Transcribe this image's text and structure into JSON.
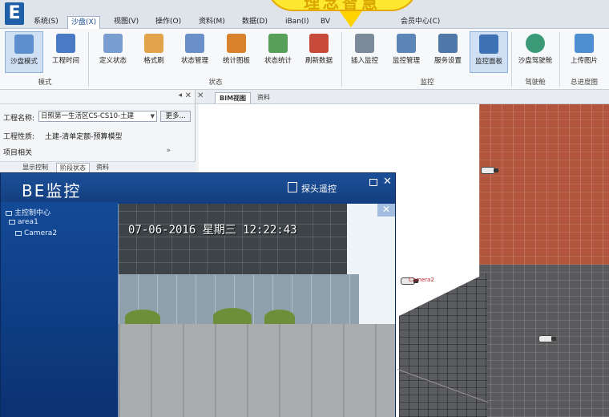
{
  "app": {
    "logo_text": "E"
  },
  "menu": {
    "tabs": [
      {
        "label": "系统(S)"
      },
      {
        "label": "沙盘(X)"
      },
      {
        "label": "视图(V)"
      },
      {
        "label": "操作(O)"
      },
      {
        "label": "资料(M)"
      },
      {
        "label": "数据(D)"
      },
      {
        "label": "iBan(I)"
      },
      {
        "label": "BV"
      },
      {
        "label": "会员中心(C)"
      }
    ],
    "active_tab": "沙盘(X)"
  },
  "promo": {
    "text": "理念智慧"
  },
  "ribbon": {
    "buttons": [
      {
        "label": "沙盘模式",
        "icon": "sandbox-mode-icon"
      },
      {
        "label": "工程时间",
        "icon": "calendar-icon"
      },
      {
        "label": "定义状态",
        "icon": "define-status-icon"
      },
      {
        "label": "格式刷",
        "icon": "format-brush-icon"
      },
      {
        "label": "状态管理",
        "icon": "status-manage-icon"
      },
      {
        "label": "统计图板",
        "icon": "stats-board-icon"
      },
      {
        "label": "状态统计",
        "icon": "status-stats-icon"
      },
      {
        "label": "刷新数据",
        "icon": "refresh-data-icon"
      },
      {
        "label": "插入监控",
        "icon": "insert-camera-icon"
      },
      {
        "label": "监控管理",
        "icon": "camera-manage-icon"
      },
      {
        "label": "服务设置",
        "icon": "service-settings-icon"
      },
      {
        "label": "监控面板",
        "icon": "monitor-panel-icon"
      },
      {
        "label": "沙盘驾驶舱",
        "icon": "cockpit-icon"
      },
      {
        "label": "上传图片",
        "icon": "upload-image-icon"
      }
    ],
    "groups": [
      {
        "label": "模式"
      },
      {
        "label": "状态"
      },
      {
        "label": "监控"
      },
      {
        "label": "驾驶舱"
      },
      {
        "label": "总进度图"
      }
    ]
  },
  "left_panel": {
    "project_name_label": "工程名称:",
    "project_name_value": "日照第一生活区CS-CS10-土建",
    "more_button": "更多...",
    "project_type_label": "工程性质:",
    "project_type_value": "土建-清单定额-预算模型",
    "related_label": "项目相关",
    "tabs": [
      {
        "label": "显示控制"
      },
      {
        "label": "阶段状态"
      },
      {
        "label": "资料"
      }
    ]
  },
  "view_tabs": [
    {
      "label": "BIM视图"
    },
    {
      "label": "资料"
    }
  ],
  "monitor": {
    "logo": "BE监控",
    "title": "探头遥控",
    "tree": [
      {
        "label": "主控制中心"
      },
      {
        "label": "area1"
      },
      {
        "label": "Camera2"
      }
    ],
    "osd_text": "07-06-2016 星期三 12:22:43"
  },
  "viewport": {
    "camera_label": "Camera2"
  }
}
